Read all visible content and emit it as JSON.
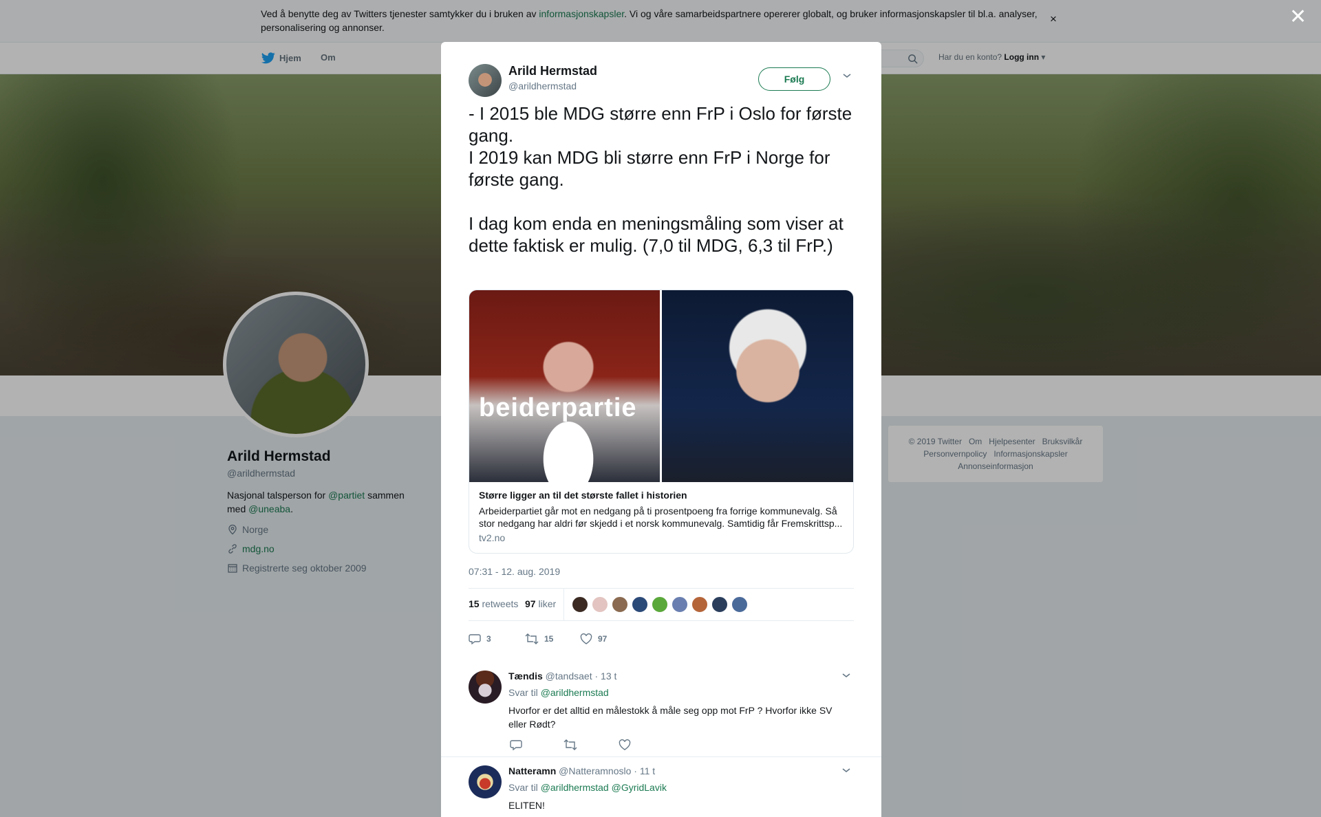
{
  "cookie_bar": {
    "text_before": "Ved å benytte deg av Twitters tjenester samtykker du i bruken av ",
    "link": "informasjonskapsler",
    "text_after": ". Vi og våre samarbeidspartnere opererer globalt, og bruker informasjonskapsler til bl.a. analyser, personalisering og annonser.",
    "close": "×"
  },
  "nav": {
    "home": "Hjem",
    "about": "Om",
    "login_prompt": "Har du en konto?",
    "login": "Logg inn"
  },
  "profile": {
    "name": "Arild Hermstad",
    "handle": "@arildhermstad",
    "bio_prefix": "Nasjonal talsperson for ",
    "bio_link1": "@partiet",
    "bio_middle": " sammen med ",
    "bio_link2": "@uneaba",
    "bio_suffix": ".",
    "location": "Norge",
    "website": "mdg.no",
    "joined": "Registrerte seg oktober 2009"
  },
  "footer": {
    "links": [
      "© 2019 Twitter",
      "Om",
      "Hjelpesenter",
      "Bruksvilkår",
      "Personvernpolicy",
      "Informasjonskapsler",
      "Annonseinformasjon"
    ]
  },
  "modal": {
    "close": "✕",
    "author": {
      "name": "Arild Hermstad",
      "handle": "@arildhermstad"
    },
    "follow_label": "Følg",
    "text": "- I 2015 ble MDG større enn FrP i Oslo for første gang.\nI 2019 kan MDG bli større enn FrP i Norge for første gang.\n\nI dag kom enda en meningsmåling som viser at dette faktisk er mulig. (7,0 til MDG, 6,3 til FrP.)",
    "card": {
      "image_word": "beiderpartie",
      "title": "Større ligger an til det største fallet i historien",
      "description": "Arbeiderpartiet går mot en nedgang på ti prosentpoeng fra forrige kommunevalg. Så stor nedgang har aldri før skjedd i et norsk kommunevalg. Samtidig får Fremskrittsp...",
      "domain": "tv2.no"
    },
    "timestamp": "07:31 - 12. aug. 2019",
    "stats": {
      "retweets_count": "15",
      "retweets_label": "retweets",
      "likes_count": "97",
      "likes_label": "liker"
    },
    "likers_colors": [
      "#3a2a22",
      "#e3c4c0",
      "#8a6a50",
      "#2c4a78",
      "#5aa83a",
      "#6a7fb0",
      "#b5653a",
      "#2a3e5c",
      "#4a6a9a"
    ],
    "actions": {
      "replies": "3",
      "retweets": "15",
      "likes": "97"
    }
  },
  "replies": [
    {
      "name": "Tændis",
      "handle": "@tandsaet",
      "time": "· 13 t",
      "reply_to_label": "Svar til",
      "reply_to": "@arildhermstad",
      "reply_to_2": "",
      "text": "Hvorfor er det alltid en målestokk å måle seg opp mot FrP ? Hvorfor ikke SV eller Rødt?"
    },
    {
      "name": "Natteramn",
      "handle": "@Natteramnoslo",
      "time": "· 11 t",
      "reply_to_label": "Svar til",
      "reply_to": "@arildhermstad",
      "reply_to_2": "@GyridLavik",
      "text": "ELITEN!"
    }
  ]
}
